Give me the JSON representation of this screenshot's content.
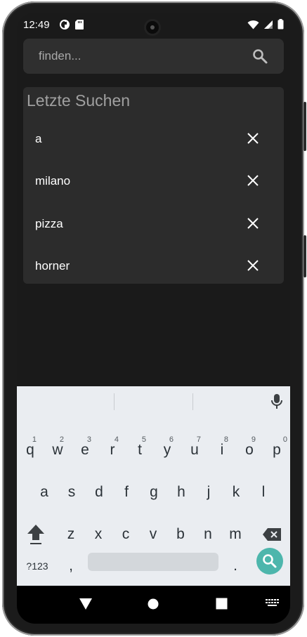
{
  "status": {
    "time": "12:49"
  },
  "search": {
    "placeholder": "finden..."
  },
  "recent": {
    "title": "Letzte Suchen",
    "items": [
      {
        "label": "a"
      },
      {
        "label": "milano"
      },
      {
        "label": "pizza"
      },
      {
        "label": "horner"
      }
    ]
  },
  "keyboard": {
    "row1": [
      "q",
      "w",
      "e",
      "r",
      "t",
      "y",
      "u",
      "i",
      "o",
      "p"
    ],
    "row1_hints": [
      "1",
      "2",
      "3",
      "4",
      "5",
      "6",
      "7",
      "8",
      "9",
      "0"
    ],
    "row2": [
      "a",
      "s",
      "d",
      "f",
      "g",
      "h",
      "j",
      "k",
      "l"
    ],
    "row3": [
      "z",
      "x",
      "c",
      "v",
      "b",
      "n",
      "m"
    ],
    "symbols_label": "?123",
    "comma": ",",
    "period": "."
  },
  "colors": {
    "accent": "#4db6ac",
    "background": "#1a1a1a",
    "panel": "#2c2c2c"
  }
}
